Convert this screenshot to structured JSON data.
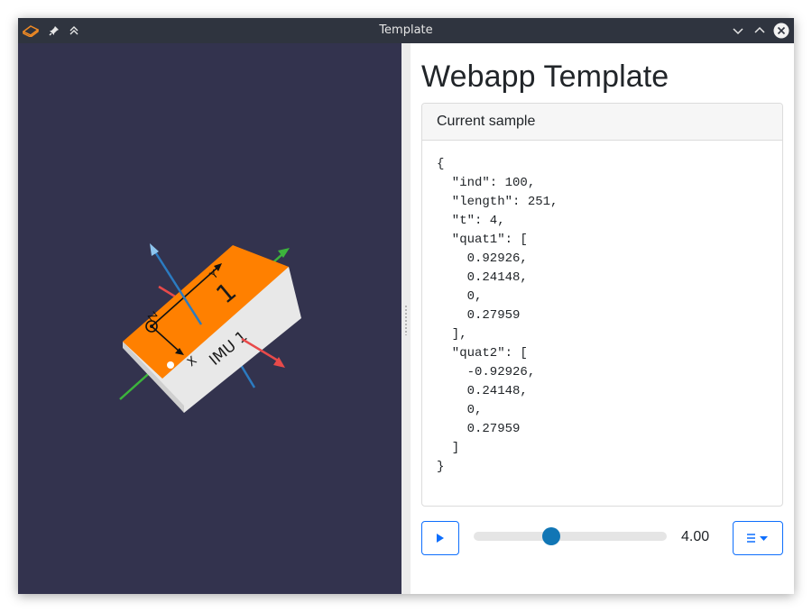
{
  "window": {
    "title": "Template",
    "app_icon": "eraser-app-icon",
    "titlebar_icons": [
      "pin-icon",
      "keep-above-icon",
      "minimize-icon",
      "maximize-icon",
      "close-icon"
    ]
  },
  "scene": {
    "background_color": "#33334e",
    "box_label": "IMU 1",
    "box_number": "1",
    "axis_labels": {
      "x": "X",
      "y": "Y",
      "z": "Z"
    },
    "colors": {
      "box_top": "#ff8000",
      "box_side": "#e8e8e8",
      "axis_red": "#e84a4a",
      "axis_green": "#3cb43c",
      "axis_blue": "#2b7bc1"
    }
  },
  "main": {
    "title": "Webapp Template",
    "card": {
      "header": "Current sample",
      "json_text": "{\n  \"ind\": 100,\n  \"length\": 251,\n  \"t\": 4,\n  \"quat1\": [\n    0.92926,\n    0.24148,\n    0,\n    0.27959\n  ],\n  \"quat2\": [\n    -0.92926,\n    0.24148,\n    0,\n    0.27959\n  ]\n}"
    },
    "controls": {
      "play_icon": "play-icon",
      "time_label": "4.00",
      "slider_fraction": 0.4,
      "menu_icon": "list-icon",
      "accent_color": "#0d6efd"
    }
  }
}
